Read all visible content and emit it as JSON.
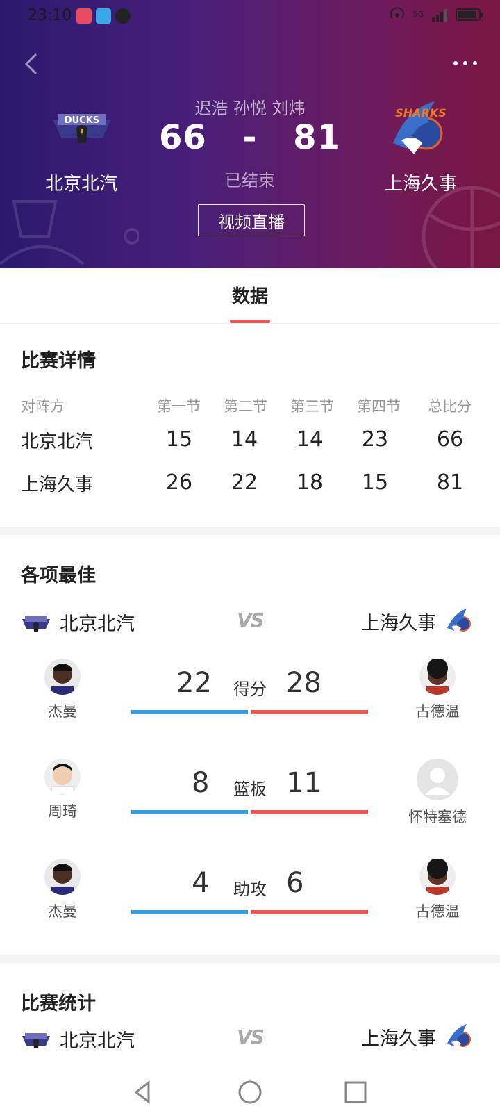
{
  "status_bar": {
    "time": "23:10",
    "signal": "5G"
  },
  "header": {
    "refs": "迟浩 孙悦 刘炜",
    "home_score": "66",
    "dash": "-",
    "away_score": "81",
    "game_status": "已结束",
    "video_button": "视频直播",
    "home_team": "北京北汽",
    "away_team": "上海久事",
    "home_logo_text": "DUCKS",
    "away_logo_text": "SHARKS"
  },
  "tabs": [
    {
      "label": "数据"
    }
  ],
  "match_detail": {
    "title": "比赛详情",
    "headers": [
      "对阵方",
      "第一节",
      "第二节",
      "第三节",
      "第四节",
      "总比分"
    ],
    "rows": [
      {
        "team": "北京北汽",
        "q1": "15",
        "q2": "14",
        "q3": "14",
        "q4": "23",
        "total": "66"
      },
      {
        "team": "上海久事",
        "q1": "26",
        "q2": "22",
        "q3": "18",
        "q4": "15",
        "total": "81"
      }
    ]
  },
  "leaders": {
    "title": "各项最佳",
    "home_team": "北京北汽",
    "away_team": "上海久事",
    "vs": "VS",
    "items": [
      {
        "label": "得分",
        "home_player": "杰曼",
        "home_value": "22",
        "away_player": "古德温",
        "away_value": "28"
      },
      {
        "label": "篮板",
        "home_player": "周琦",
        "home_value": "8",
        "away_player": "怀特塞德",
        "away_value": "11"
      },
      {
        "label": "助攻",
        "home_player": "杰曼",
        "home_value": "4",
        "away_player": "古德温",
        "away_value": "6"
      }
    ]
  },
  "match_stats": {
    "title": "比赛统计",
    "home_team": "北京北汽",
    "away_team": "上海久事",
    "vs": "VS"
  },
  "colors": {
    "home_bar": "#3d9be0",
    "away_bar": "#e85a5a",
    "tab_accent": "#ee5a5a"
  }
}
